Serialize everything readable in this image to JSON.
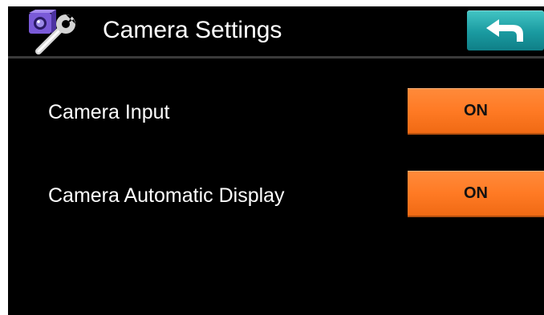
{
  "header": {
    "title": "Camera Settings",
    "icon": "camera-wrench-icon",
    "back_icon": "back-arrow-icon"
  },
  "settings": [
    {
      "label": "Camera Input",
      "value": "ON"
    },
    {
      "label": "Camera Automatic Display",
      "value": "ON"
    }
  ],
  "colors": {
    "background": "#000000",
    "toggle": "#ff7a24",
    "back_button": "#1a9aa0",
    "icon_purple": "#6a4bc4"
  }
}
